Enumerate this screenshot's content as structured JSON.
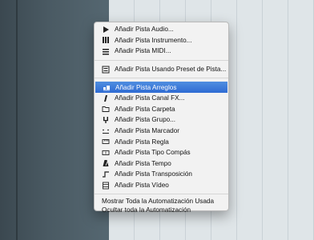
{
  "menu": {
    "items": [
      {
        "label": "Añadir Pista Audio...",
        "icon": "play-icon"
      },
      {
        "label": "Añadir Pista Instrumento...",
        "icon": "piano-keys-icon"
      },
      {
        "label": "Añadir Pista MIDI...",
        "icon": "midi-icon"
      },
      {
        "label": "Añadir Pista Usando Preset de Pista...",
        "icon": "list-icon"
      },
      {
        "label": "Añadir Pista Arreglos",
        "icon": "arranger-icon",
        "selected": true
      },
      {
        "label": "Añadir Pista Canal FX...",
        "icon": "fx-icon"
      },
      {
        "label": "Añadir Pista Carpeta",
        "icon": "folder-icon"
      },
      {
        "label": "Añadir Pista Grupo...",
        "icon": "group-icon"
      },
      {
        "label": "Añadir Pista Marcador",
        "icon": "marker-icon"
      },
      {
        "label": "Añadir Pista Regla",
        "icon": "ruler-icon"
      },
      {
        "label": "Añadir Pista Tipo Compás",
        "icon": "signature-icon"
      },
      {
        "label": "Añadir Pista Tempo",
        "icon": "tempo-icon"
      },
      {
        "label": "Añadir Pista Transposición",
        "icon": "transpose-icon"
      },
      {
        "label": "Añadir Pista Vídeo",
        "icon": "video-icon"
      }
    ],
    "footer_items": [
      "Mostrar Toda la Automatización Usada",
      "Ocultar toda la Automatización"
    ]
  },
  "colors": {
    "selection": "#2f6bd3",
    "menu_bg": "#f2f2f2"
  }
}
